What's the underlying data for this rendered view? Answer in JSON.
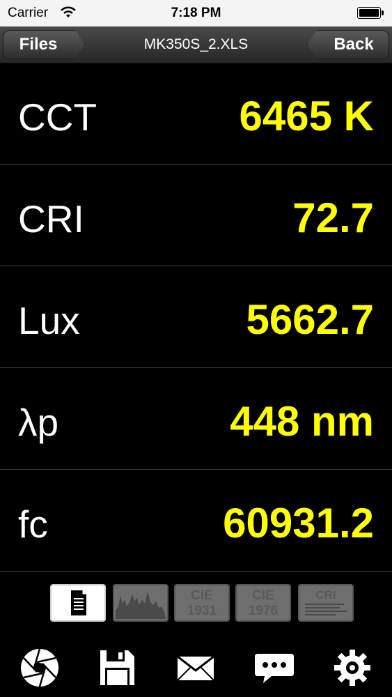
{
  "status_bar": {
    "carrier": "Carrier",
    "time": "7:18 PM"
  },
  "nav": {
    "title": "MK350S_2.XLS",
    "left_button": "Files",
    "right_button": "Back"
  },
  "measurements": [
    {
      "label": "CCT",
      "value": "6465 K"
    },
    {
      "label": "CRI",
      "value": "72.7"
    },
    {
      "label": "Lux",
      "value": "5662.7"
    },
    {
      "label": "λp",
      "value": "448 nm"
    },
    {
      "label": "fc",
      "value": "60931.2"
    }
  ],
  "view_tabs": [
    {
      "icon": "document-icon",
      "active": true
    },
    {
      "icon": "spectrum-icon",
      "active": false
    },
    {
      "icon": "cie1931-icon",
      "line1": "CIE",
      "line2": "1931",
      "active": false
    },
    {
      "icon": "cie1976-icon",
      "line1": "CIE",
      "line2": "1976",
      "active": false
    },
    {
      "icon": "cri-icon",
      "line1": "CRI",
      "active": false
    }
  ],
  "toolbar": [
    "aperture-icon",
    "save-icon",
    "mail-icon",
    "message-icon",
    "gear-icon"
  ],
  "colors": {
    "value": "#ffff00",
    "label": "#ffffff",
    "background": "#000000"
  }
}
